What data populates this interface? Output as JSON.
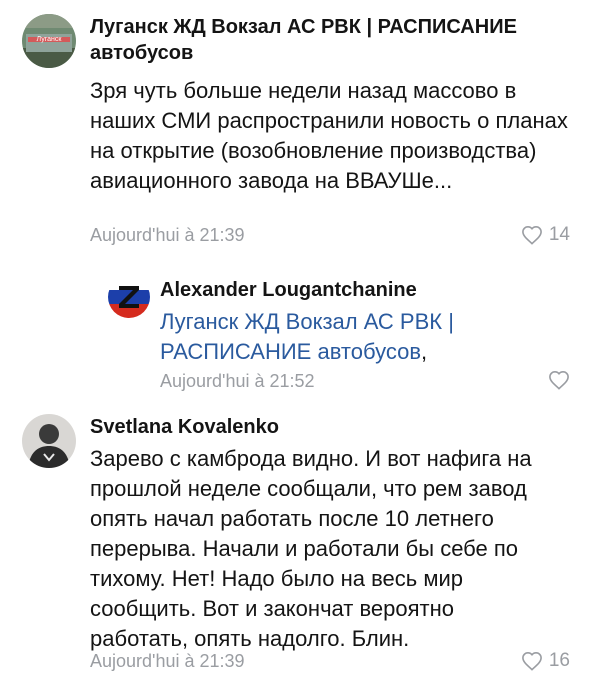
{
  "comments": [
    {
      "author": "Луганск ЖД Вокзал АС РВК | РАСПИСАНИЕ автобусов",
      "avatar_icon": "bus-station-avatar",
      "text": "Зря чуть больше недели назад массово в наших СМИ распространили новость о планах на открытие (возобновление производства) авиационного завода на ВВАУШе...",
      "time": "Aujourd'hui à 21:39",
      "likes": "14"
    },
    {
      "author": "Alexander Lougantchanine",
      "avatar_icon": "z-flag-avatar",
      "mention": "Луганск ЖД Вокзал АС РВК | РАСПИСАНИЕ автобусов",
      "mention_suffix": ",",
      "time": "Aujourd'hui à 21:52",
      "likes": ""
    },
    {
      "author": "Svetlana Kovalenko",
      "avatar_icon": "person-avatar",
      "text": "Зарево с камброда видно. И вот нафига на прошлой неделе сообщали, что рем завод опять начал работать после 10 летнего перерыва. Начали и работали бы себе по тихому. Нет! Надо было на весь мир сообщить. Вот и закончат вероятно работать, опять надолго. Блин.",
      "time": "Aujourd'hui à 21:39",
      "likes": "16"
    }
  ],
  "colors": {
    "link": "#2a5a9e",
    "meta": "#9a9da2"
  }
}
